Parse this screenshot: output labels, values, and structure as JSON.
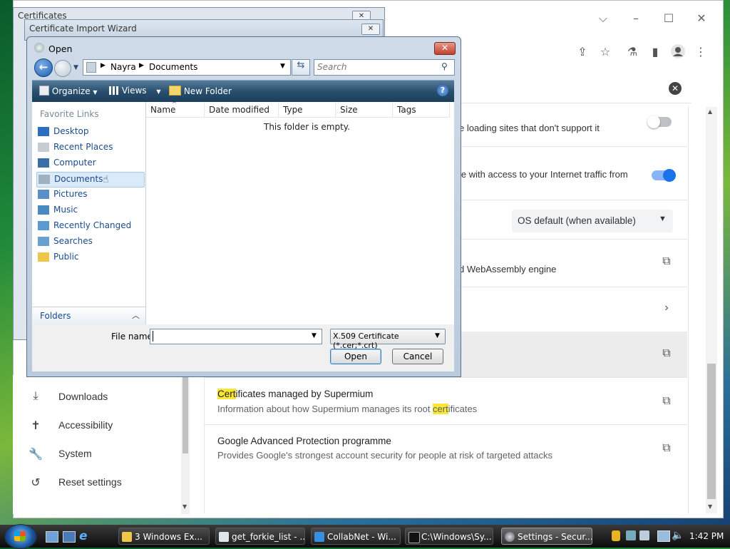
{
  "browser": {
    "settings": {
      "row1_text": "e loading sites that don't support it",
      "row2_text": "le with access to your Internet traffic from",
      "dropdown_value": "OS default (when available)",
      "row4_text": "d WebAssembly engine",
      "cert_title_pre": "Cert",
      "cert_title_post": "ificates managed by Supermium",
      "cert_desc_pre": "Information about how Supermium manages its root ",
      "cert_desc_hl": "cert",
      "cert_desc_post": "ificates",
      "gap_title": "Google Advanced Protection programme",
      "gap_desc": "Provides Google's strongest account security for people at risk of targeted attacks"
    },
    "sidebar": {
      "items": [
        {
          "label": "Downloads",
          "icon": "download-icon"
        },
        {
          "label": "Accessibility",
          "icon": "accessibility-icon"
        },
        {
          "label": "System",
          "icon": "wrench-icon"
        },
        {
          "label": "Reset settings",
          "icon": "reset-icon"
        }
      ]
    }
  },
  "behind": {
    "certificates_title": "Certificates",
    "import_wizard_title": "Certificate Import Wizard"
  },
  "open_dialog": {
    "title": "Open",
    "breadcrumb": [
      "Nayra",
      "Documents"
    ],
    "search_placeholder": "Search",
    "toolbar": {
      "organize": "Organize",
      "views": "Views",
      "new_folder": "New Folder"
    },
    "favorite_links_header": "Favorite Links",
    "favorites": [
      "Desktop",
      "Recent Places",
      "Computer",
      "Documents",
      "Pictures",
      "Music",
      "Recently Changed",
      "Searches",
      "Public"
    ],
    "selected_favorite": "Documents",
    "folders_label": "Folders",
    "columns": [
      "Name",
      "Date modified",
      "Type",
      "Size",
      "Tags"
    ],
    "empty_message": "This folder is empty.",
    "file_name_label": "File name:",
    "file_name_value": "",
    "file_type": "X.509 Certificate (*.cer;*.crt)",
    "open_button": "Open",
    "cancel_button": "Cancel"
  },
  "taskbar": {
    "tasks": [
      "3 Windows Ex...",
      "get_forkie_list - ...",
      "CollabNet - Wi...",
      "C:\\Windows\\Sy...",
      "Settings - Secur..."
    ],
    "active_task": "Settings - Secur...",
    "clock": "1:42 PM"
  },
  "colors": {
    "toggle_on": "#1a73e8",
    "highlight": "#f9e637",
    "vista_link": "#1a4b8c"
  }
}
